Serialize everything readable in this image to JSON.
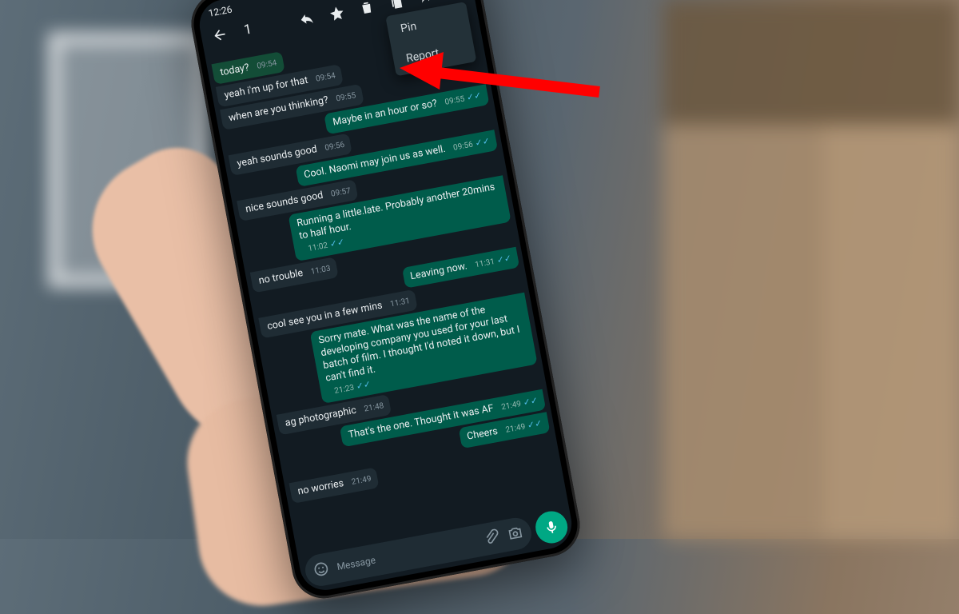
{
  "status": {
    "time": "12:26",
    "icons": [
      "x-icon",
      "headphone-icon",
      "bluetooth-icon",
      "wifi-icon",
      "signal-icon",
      "battery-icon"
    ]
  },
  "actionbar": {
    "selected_count": "1",
    "popup": {
      "pin": "Pin",
      "report": "Report"
    }
  },
  "messages": [
    {
      "side": "in",
      "selected": true,
      "text": "today?",
      "time": "09:54",
      "ticks": false
    },
    {
      "side": "in",
      "text": "yeah i'm up for that",
      "time": "09:54",
      "ticks": false
    },
    {
      "side": "in",
      "text": "when are you thinking?",
      "time": "09:55",
      "ticks": false
    },
    {
      "side": "out",
      "text": "Maybe in an hour or so?",
      "time": "09:55",
      "ticks": true
    },
    {
      "side": "in",
      "text": "yeah sounds good",
      "time": "09:56",
      "ticks": false
    },
    {
      "side": "out",
      "text": "Cool. Naomi may join us as well.",
      "time": "09:56",
      "ticks": true
    },
    {
      "side": "in",
      "text": "nice sounds good",
      "time": "09:57",
      "ticks": false
    },
    {
      "side": "out",
      "text": "Running a little.late. Probably another 20mins to half hour.",
      "time": "11:02",
      "ticks": true
    },
    {
      "side": "in",
      "text": "no trouble",
      "time": "11:03",
      "ticks": false
    },
    {
      "side": "out",
      "text": "Leaving now.",
      "time": "11:31",
      "ticks": true
    },
    {
      "side": "in",
      "text": "cool see you in a few mins",
      "time": "11:31",
      "ticks": false
    },
    {
      "side": "out",
      "text": "Sorry mate. What was the name of the developing company you used for your last batch of film. I thought I'd noted it down, but I can't find it.",
      "time": "21:23",
      "ticks": true
    },
    {
      "side": "in",
      "text": "ag photographic",
      "time": "21:48",
      "ticks": false
    },
    {
      "side": "out",
      "text": "That's the one. Thought it was AF",
      "time": "21:49",
      "ticks": true
    },
    {
      "side": "out",
      "text": "Cheers",
      "time": "21:49",
      "ticks": true
    },
    {
      "side": "in",
      "text": "no worries",
      "time": "21:49",
      "ticks": false
    }
  ],
  "input": {
    "placeholder": "Message"
  }
}
